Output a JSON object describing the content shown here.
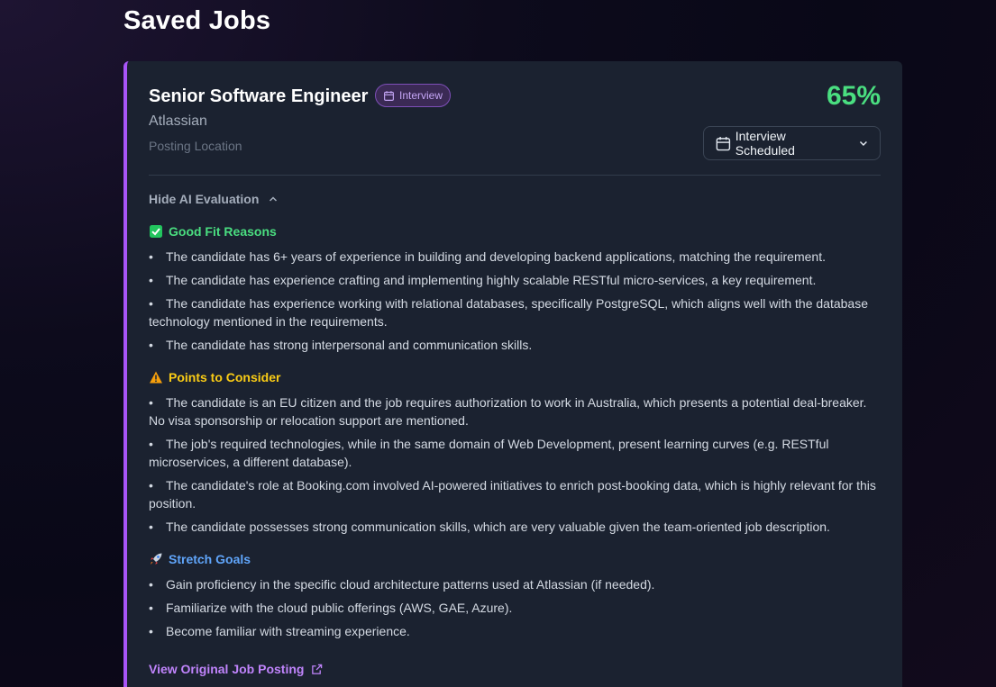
{
  "page": {
    "title": "Saved Jobs"
  },
  "job": {
    "title": "Senior Software Engineer",
    "status_badge": "Interview",
    "company": "Atlassian",
    "location": "Posting Location",
    "score": "65%",
    "status_select": "Interview Scheduled"
  },
  "evaluation": {
    "toggle_label": "Hide AI Evaluation",
    "good_fit": {
      "title": "Good Fit Reasons",
      "icon": "check-box-icon",
      "items": [
        "The candidate has 6+ years of experience in building and developing backend applications, matching the requirement.",
        "The candidate has experience crafting and implementing highly scalable RESTful micro-services, a key requirement.",
        "The candidate has experience working with relational databases, specifically PostgreSQL, which aligns well with the database technology mentioned in the requirements.",
        "The candidate has strong interpersonal and communication skills."
      ]
    },
    "points": {
      "title": "Points to Consider",
      "icon": "warning-icon",
      "items": [
        "The candidate is an EU citizen and the job requires authorization to work in Australia, which presents a potential deal-breaker. No visa sponsorship or relocation support are mentioned.",
        "The job's required technologies, while in the same domain of Web Development, present learning curves (e.g. RESTful microservices, a different database).",
        "The candidate's role at Booking.com involved AI-powered initiatives to enrich post-booking data, which is highly relevant for this position.",
        "The candidate possesses strong communication skills, which are very valuable given the team-oriented job description."
      ]
    },
    "stretch": {
      "title": "Stretch Goals",
      "icon": "rocket-icon",
      "items": [
        "Gain proficiency in the specific cloud architecture patterns used at Atlassian (if needed).",
        "Familiarize with the cloud public offerings (AWS, GAE, Azure).",
        "Become familiar with streaming experience."
      ]
    }
  },
  "link": {
    "label": "View Original Job Posting"
  },
  "colors": {
    "accent": "#a855f7",
    "score": "#4ade80",
    "good": "#4ade80",
    "warning": "#facc15",
    "stretch": "#60a5fa",
    "link": "#c084fc"
  }
}
